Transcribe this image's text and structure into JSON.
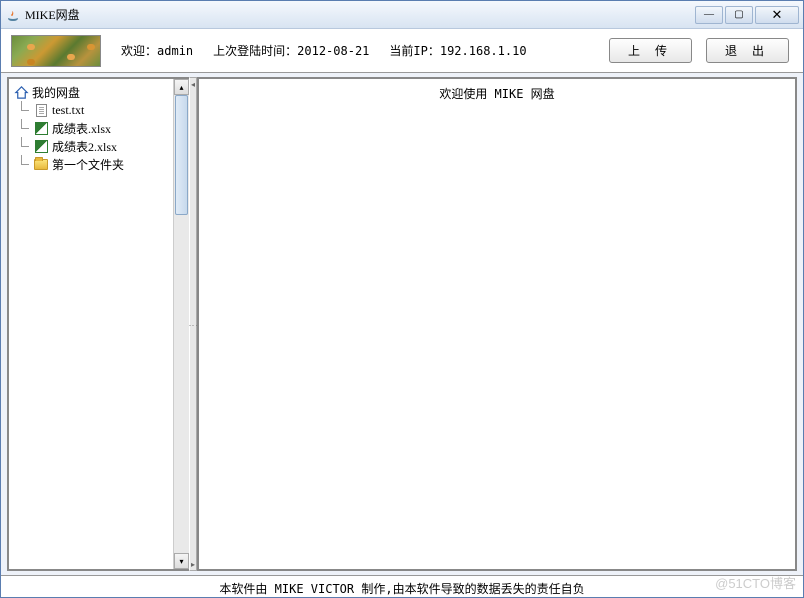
{
  "window": {
    "title": "MIKE网盘"
  },
  "header": {
    "welcome_label": "欢迎：",
    "welcome_user": "admin",
    "lastlogin_label": "上次登陆时间：",
    "lastlogin_value": "2012-08-21",
    "ip_label": "当前IP：",
    "ip_value": "192.168.1.10",
    "upload_btn": "上 传",
    "logout_btn": "退  出"
  },
  "tree": {
    "root": "我的网盘",
    "children": [
      {
        "label": "test.txt",
        "type": "file"
      },
      {
        "label": "成绩表.xlsx",
        "type": "xlsx"
      },
      {
        "label": "成绩表2.xlsx",
        "type": "xlsx"
      },
      {
        "label": "第一个文件夹",
        "type": "folder"
      }
    ]
  },
  "content": {
    "welcome": "欢迎使用 MIKE 网盘"
  },
  "footer": {
    "text": "本软件由 MIKE VICTOR 制作,由本软件导致的数据丢失的责任自负"
  },
  "watermark": "@51CTO博客"
}
